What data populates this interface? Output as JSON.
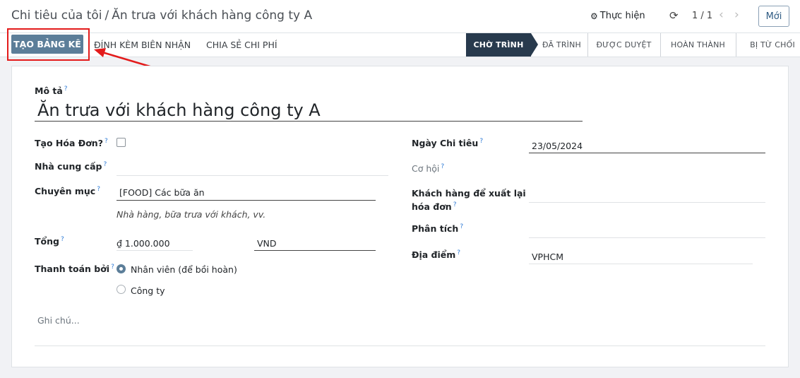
{
  "breadcrumb": {
    "parent": "Chi tiêu của tôi",
    "separator": "/",
    "current": "Ăn trưa với khách hàng công ty A"
  },
  "topbar": {
    "action_label": "Thực hiện",
    "pager": "1 / 1",
    "new_label": "Mới"
  },
  "toolbar": {
    "primary_label": "TẠO BẢNG KÊ",
    "attach_label": "ĐÍNH KÈM BIÊN NHẬN",
    "share_label": "CHIA SẺ CHI PHÍ"
  },
  "stages": [
    {
      "label": "CHỜ TRÌNH",
      "active": true
    },
    {
      "label": "ĐÃ TRÌNH",
      "active": false
    },
    {
      "label": "ĐƯỢC DUYỆT",
      "active": false
    },
    {
      "label": "HOÀN THÀNH",
      "active": false
    },
    {
      "label": "BỊ TỪ CHỐI",
      "active": false
    }
  ],
  "form": {
    "description_label": "Mô tả",
    "description_value": "Ăn trưa với khách hàng công ty A",
    "invoice_label": "Tạo Hóa Đơn?",
    "vendor_label": "Nhà cung cấp",
    "category_label": "Chuyên mục",
    "category_value": "[FOOD] Các bữa ăn",
    "category_hint": "Nhà hàng, bữa trưa với khách, vv.",
    "total_label": "Tổng",
    "total_value": "₫ 1.000.000",
    "currency_value": "VND",
    "paid_by_label": "Thanh toán bởi",
    "paid_by_employee": "Nhân viên (để bồi hoàn)",
    "paid_by_company": "Công ty",
    "date_label": "Ngày Chi tiêu",
    "date_value": "23/05/2024",
    "opportunity_label": "Cơ hội",
    "reinvoice_label_1": "Khách hàng để xuất lại",
    "reinvoice_label_2": "hóa đơn",
    "analytic_label": "Phân tích",
    "location_label": "Địa điểm",
    "location_value": "VPHCM",
    "notes_placeholder": "Ghi chú...",
    "help_mark": "?"
  },
  "colors": {
    "primary": "#5c7e99",
    "active_stage": "#283a4d",
    "annotation": "#e31b1b"
  }
}
